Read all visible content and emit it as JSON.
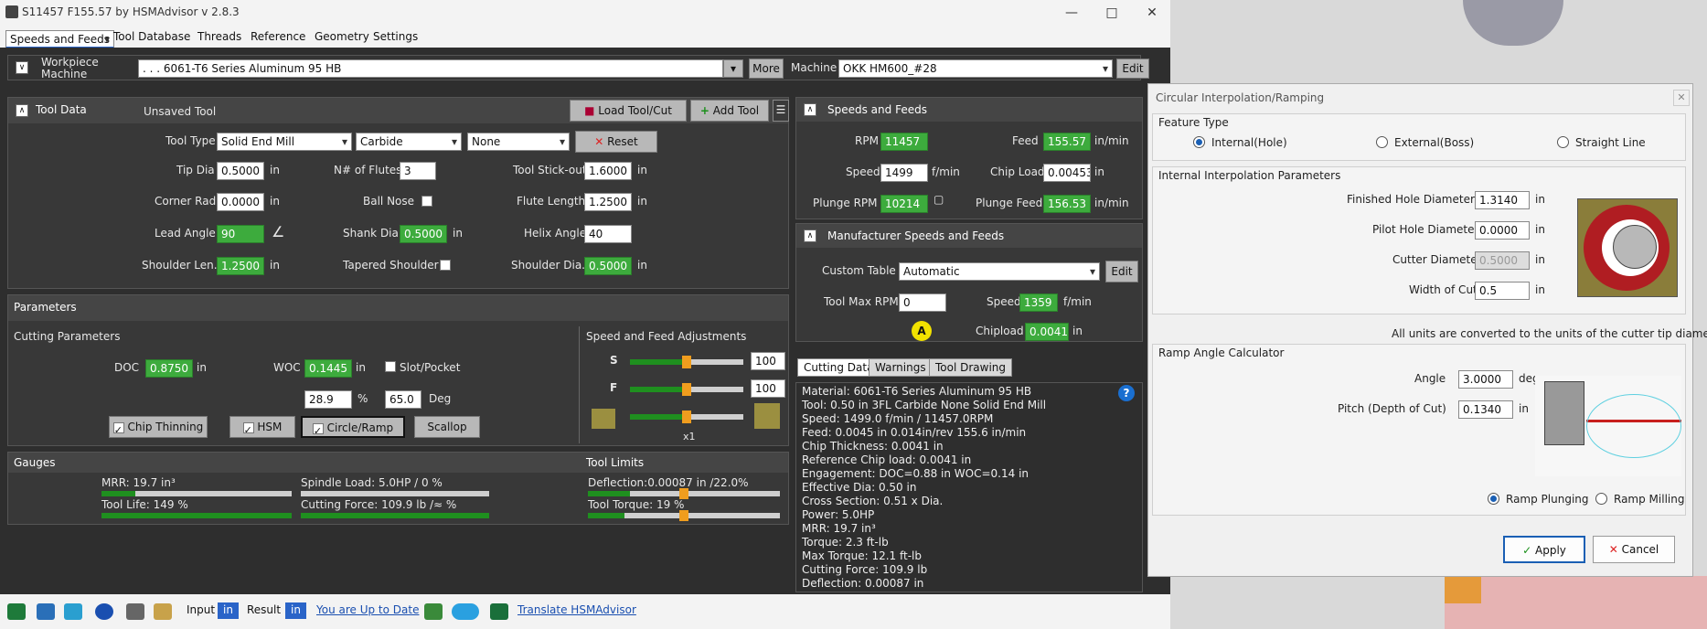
{
  "window": {
    "title": "S11457 F155.57 by HSMAdvisor v 2.8.3"
  },
  "menu": [
    "Speeds and Feeds",
    "Tool Database",
    "Threads",
    "Reference",
    "Geometry",
    "Settings"
  ],
  "workpiece": {
    "label1": "Workpiece",
    "label2": "Machine",
    "material": ". . . 6061-T6 Series Aluminum 95 HB",
    "more": "More",
    "machine_label": "Machine",
    "machine": "OKK HM600_#28",
    "edit": "Edit"
  },
  "tool": {
    "header": "Tool Data",
    "unsaved": "Unsaved Tool",
    "load": "Load Tool/Cut",
    "add": "Add Tool",
    "type_label": "Tool Type",
    "type": "Solid End Mill",
    "material": "Carbide",
    "coating": "None",
    "reset": "Reset",
    "tipdia_label": "Tip Dia",
    "tipdia": "0.5000",
    "flutes_label": "N# of Flutes",
    "flutes": "3",
    "stickout_label": "Tool Stick-out",
    "stickout": "1.6000",
    "cornerrad_label": "Corner Rad",
    "cornerrad": "0.0000",
    "ballnose_label": "Ball Nose",
    "flutelen_label": "Flute Length",
    "flutelen": "1.2500",
    "leadangle_label": "Lead Angle",
    "leadangle": "90",
    "shankdia_label": "Shank Dia",
    "shankdia": "0.5000",
    "helix_label": "Helix Angle",
    "helix": "40",
    "shoulderlen_label": "Shoulder Len.",
    "shoulderlen": "1.2500",
    "tapered_label": "Tapered Shoulder",
    "shoulderdia_label": "Shoulder Dia.",
    "shoulderdia": "0.5000",
    "unit": "in"
  },
  "params": {
    "header": "Parameters",
    "cutting": "Cutting Parameters",
    "adjust": "Speed and Feed Adjustments",
    "doc_label": "DOC",
    "doc": "0.8750",
    "woc_label": "WOC",
    "woc": "0.1445",
    "slot": "Slot/Pocket",
    "pct": "28.9",
    "pct_unit": "%",
    "deg": "65.0",
    "deg_unit": "Deg",
    "chip": "Chip Thinning",
    "hsm": "HSM",
    "circ": "Circle/Ramp",
    "scallop": "Scallop",
    "s_label": "S",
    "s": "100",
    "f_label": "F",
    "f": "100",
    "mult": "x1",
    "s_level": 0.5,
    "f_level": 0.5,
    "t_level": 0.5
  },
  "gauges": {
    "header": "Gauges",
    "limits": "Tool Limits",
    "mrr": "MRR: 19.7 in³",
    "spindle": "Spindle Load: 5.0HP / 0 %",
    "life": "Tool Life: 149 %",
    "force": "Cutting Force: 109.9 lb /≈ %",
    "defl": "Deflection:0.00087 in /22.0%",
    "torque": "Tool Torque: 19 %",
    "mrr_level": 0.18,
    "spindle_level": 0,
    "life_level": 1.0,
    "force_level": 1.0,
    "defl_level": 0.22,
    "torque_level": 0.19
  },
  "sf": {
    "header": "Speeds and Feeds",
    "rpm_label": "RPM",
    "rpm": "11457",
    "feed_label": "Feed",
    "feed": "155.57",
    "feed_unit": "in/min",
    "speed_label": "Speed",
    "speed": "1499",
    "speed_unit": "f/min",
    "chip_label": "Chip Load",
    "chip": "0.00453",
    "chip_unit": "in",
    "prpm_label": "Plunge RPM",
    "prpm": "10214",
    "pfeed_label": "Plunge Feed",
    "pfeed": "156.53",
    "pfeed_unit": "in/min"
  },
  "mfr": {
    "header": "Manufacturer Speeds and Feeds",
    "table_label": "Custom Table",
    "table": "Automatic",
    "edit": "Edit",
    "maxrpm_label": "Tool Max RPM",
    "maxrpm": "0",
    "speed_label": "Speed",
    "speed": "1359",
    "speed_unit": "f/min",
    "badge": "A",
    "chipload_label": "Chipload",
    "chipload": "0.00410",
    "chipload_unit": "in"
  },
  "tabs": [
    "Cutting Data",
    "Warnings",
    "Tool Drawing"
  ],
  "cutting_data": [
    "Material: 6061-T6 Series Aluminum 95 HB",
    "Tool: 0.50 in 3FL Carbide None Solid End Mill",
    "Speed: 1499.0 f/min / 11457.0RPM",
    "Feed: 0.0045 in 0.014in/rev 155.6 in/min",
    "Chip Thickness: 0.0041 in",
    "Reference Chip load: 0.0041 in",
    "Engagement: DOC=0.88 in WOC=0.14 in",
    "Effective Dia: 0.50 in",
    "Cross Section: 0.51 x Dia.",
    "Power: 5.0HP",
    "MRR: 19.7 in³",
    "Torque: 2.3 ft-lb",
    "Max Torque: 12.1 ft-lb",
    "Cutting Force: 109.9 lb",
    "Deflection: 0.00087 in"
  ],
  "status": {
    "input": "Input",
    "input_unit": "in",
    "result": "Result",
    "result_unit": "in",
    "uptodate": "You are Up to Date",
    "translate": "Translate HSMAdvisor"
  },
  "dialog": {
    "title": "Circular Interpolation/Ramping",
    "feature": "Feature Type",
    "r1": "Internal(Hole)",
    "r2": "External(Boss)",
    "r3": "Straight Line",
    "iip": "Internal Interpolation Parameters",
    "fhd_label": "Finished Hole Diameter",
    "fhd": "1.3140",
    "phd_label": "Pilot Hole Diameter",
    "phd": "0.0000",
    "cd_label": "Cutter Diameter",
    "cd": "0.5000",
    "woc_label": "Width of Cut",
    "woc": "0.5",
    "unit": "in",
    "note": "All units are converted to the units of the cutter tip diameter",
    "ramp": "Ramp Angle Calculator",
    "angle_label": "Angle",
    "angle": "3.0000",
    "angle_unit": "deg",
    "pitch_label": "Pitch (Depth of Cut)",
    "pitch": "0.1340",
    "rp": "Ramp Plunging",
    "rm": "Ramp Milling",
    "apply": "Apply",
    "cancel": "Cancel"
  }
}
